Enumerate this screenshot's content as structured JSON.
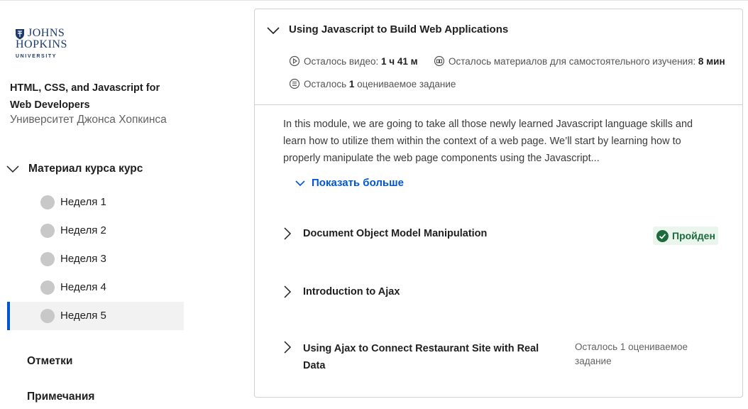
{
  "university": {
    "logo_line1": "JOHNS",
    "logo_line2": "HOPKINS",
    "logo_line3": "UNIVERSITY",
    "brand_color": "#1c3a6e"
  },
  "course": {
    "title": "HTML, CSS, and Javascript for Web Developers",
    "university_name": "Университет Джонса Хопкинса"
  },
  "sidebar": {
    "material_label": "Материал курса курс",
    "weeks": [
      {
        "label": "Неделя 1",
        "active": false
      },
      {
        "label": "Неделя 2",
        "active": false
      },
      {
        "label": "Неделя 3",
        "active": false
      },
      {
        "label": "Неделя 4",
        "active": false
      },
      {
        "label": "Неделя 5",
        "active": true
      }
    ],
    "grades_label": "Отметки",
    "notes_label": "Примечания",
    "accent_color": "#0056d2"
  },
  "module": {
    "title": "Using Javascript to Build Web Applications",
    "video_label": "Осталось видео:",
    "video_value": "1 ч 41 м",
    "reading_label": "Осталось материалов для самостоятельного изучения:",
    "reading_value": "8 мин",
    "graded_prefix": "Осталось",
    "graded_count": "1",
    "graded_suffix": "оцениваемое задание",
    "description": "In this module, we are going to take all those newly learned Javascript language skills and learn how to utilize them within the context of a web page. We’ll start by learning how to properly manipulate the web page components using the Javascript...",
    "show_more": "Показать больше",
    "lessons": [
      {
        "title": "Document Object Model Manipulation",
        "status": "Пройден"
      },
      {
        "title": "Introduction to Ajax",
        "status": ""
      },
      {
        "title": "Using Ajax to Connect Restaurant Site with Real Data",
        "status": "Осталось 1 оцениваемое задание"
      }
    ],
    "completed_color": "#1c6b3c"
  }
}
